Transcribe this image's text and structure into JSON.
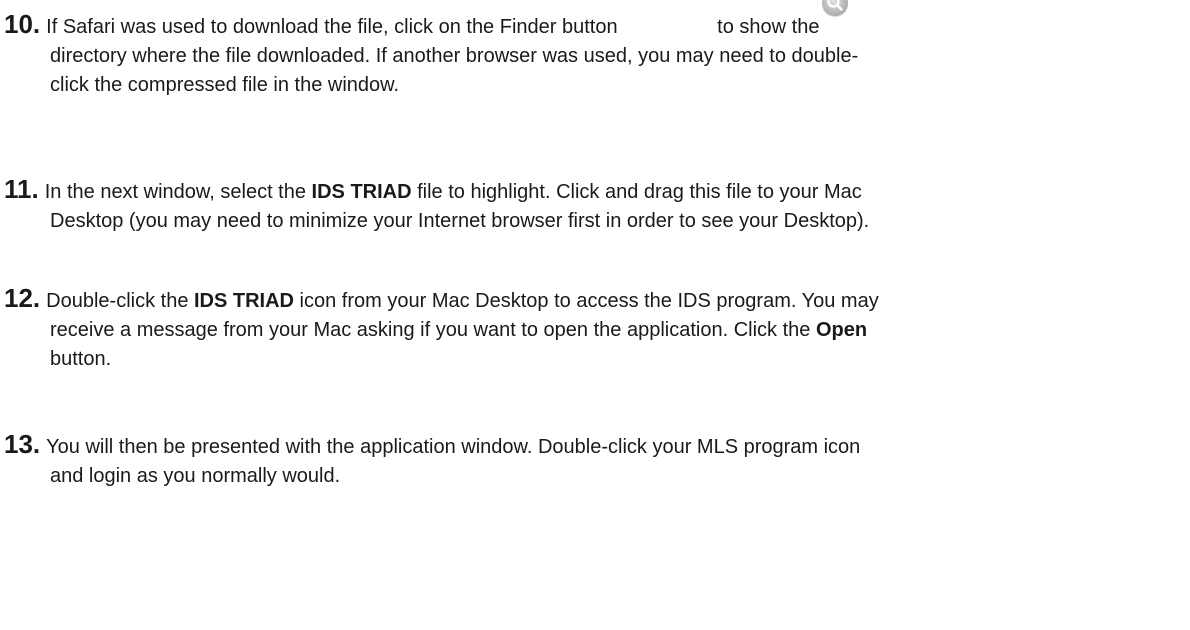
{
  "steps": [
    {
      "number": "10.",
      "line1_before": "If Safari was used to download the file, click on the Finder button",
      "line1_after": "to show the",
      "line2": "directory where the file downloaded.  If another browser was used, you may need to double-",
      "line3": "click the compressed file in the window.",
      "icon": "finder-magnifier-icon"
    },
    {
      "number": "11.",
      "line1_a": "In the next window, select the ",
      "line1_bold": "IDS TRIAD",
      "line1_b": " file to highlight. Click and drag this file to your Mac",
      "line2": "Desktop (you may need to minimize your Internet browser first in order to see your Desktop)."
    },
    {
      "number": "12.",
      "line1_a": "Double-click the ",
      "line1_bold": "IDS TRIAD",
      "line1_b": " icon from your Mac Desktop to access the IDS program. You may",
      "line2_a": "receive a message from your Mac asking if you want to open the application. Click the ",
      "line2_bold": "Open",
      "line3": "button."
    },
    {
      "number": "13.",
      "line1": "You will then be presented with the application window. Double-click your MLS program icon",
      "line2": "and login as you normally would."
    }
  ]
}
